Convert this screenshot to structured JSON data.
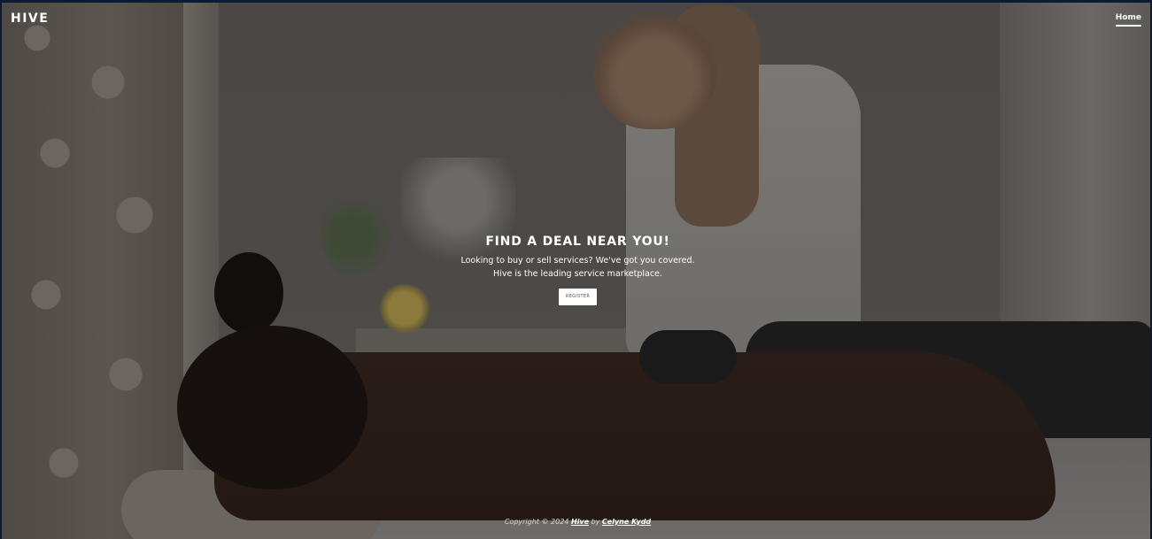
{
  "nav": {
    "brand": "HIVE",
    "links": [
      {
        "label": "Home",
        "active": true
      }
    ]
  },
  "hero": {
    "title": "FIND A DEAL NEAR YOU!",
    "line1": "Looking to buy or sell services? We've got you covered.",
    "line2": "Hive is the leading service marketplace.",
    "cta_label": "REGISTER"
  },
  "footer": {
    "prefix": "Copyright © 2024",
    "site_link": "Hive",
    "by": "by",
    "author_link": "Celyne Kydd"
  },
  "colors": {
    "frame_border": "#0d1a33",
    "text": "#ffffff",
    "button_bg": "#ffffff"
  }
}
